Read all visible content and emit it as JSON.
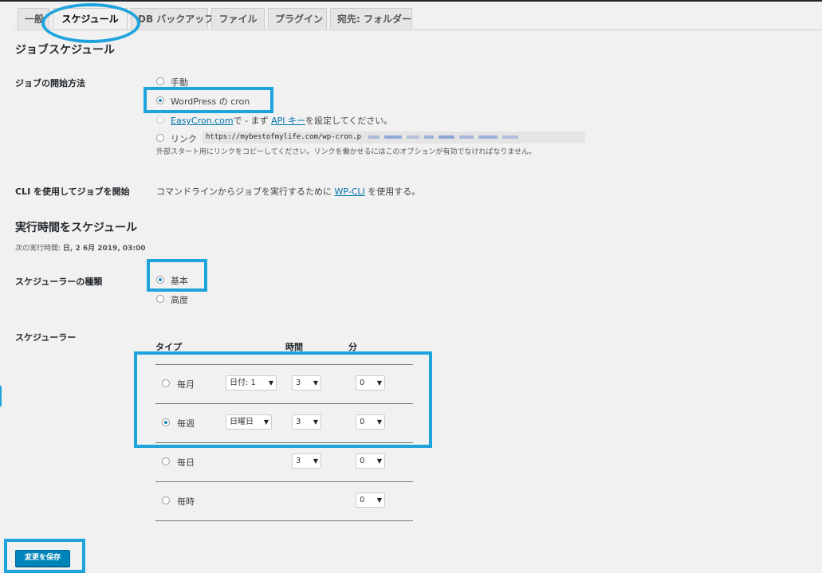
{
  "tabs": [
    "一般",
    "スケジュール",
    "DB バックアップ",
    "ファイル",
    "プラグイン",
    "宛先: フォルダー"
  ],
  "job_schedule": {
    "heading": "ジョブスケジュール",
    "start_label": "ジョブの開始方法",
    "option_manual": "手動",
    "option_wpcron": "WordPress の cron",
    "easycron_link": "EasyCron.com",
    "easycron_mid": "で - まず",
    "api_key_link": "API キー",
    "easycron_tail": "を設定してください。",
    "option_link": "リンク",
    "link_url": "https://mybestofmylife.com/wp-cron.p",
    "link_hint": "外部スタート用にリンクをコピーしてください。リンクを働かせるにはこのオプションが有効でなければなりません。",
    "selected": "WordPress の cron"
  },
  "cli": {
    "label": "CLI を使用してジョブを開始",
    "text_before": "コマンドラインからジョブを実行するために",
    "link": "WP-CLI",
    "text_after": "を使用する。"
  },
  "exec_schedule": {
    "heading": "実行時間をスケジュール",
    "next_run_label": "次の実行時間:",
    "next_run_value": "日, 2 6月 2019, 03:00",
    "type_label": "スケジューラーの種類",
    "type_basic": "基本",
    "type_advanced": "高度",
    "type_selected": "基本"
  },
  "scheduler": {
    "label": "スケジューラー",
    "col_type": "タイプ",
    "col_hour": "時間",
    "col_minute": "分",
    "rows": [
      {
        "type": "毎月",
        "day": "日付: 1",
        "hour": "3",
        "minute": "0",
        "selected": false
      },
      {
        "type": "毎週",
        "day": "日曜日",
        "hour": "3",
        "minute": "0",
        "selected": true
      },
      {
        "type": "毎日",
        "day": "",
        "hour": "3",
        "minute": "0",
        "selected": false
      },
      {
        "type": "毎時",
        "day": "",
        "hour": "",
        "minute": "0",
        "selected": false
      }
    ]
  },
  "save_button": "変更を保存",
  "colors": {
    "highlight": "#1ea3dc",
    "primary_button": "#0085ba",
    "link": "#0073aa"
  }
}
